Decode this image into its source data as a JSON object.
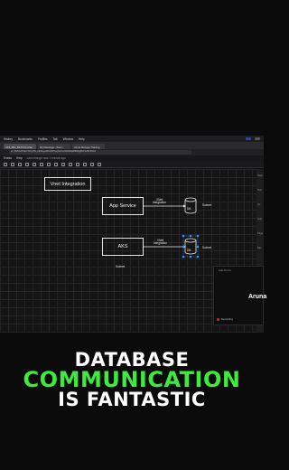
{
  "menubar": {
    "items": [
      "History",
      "Bookmarks",
      "Profiles",
      "Tab",
      "Window",
      "Help"
    ]
  },
  "tabs": [
    {
      "label": "AZ1_IBN_BATCH1(shar..."
    },
    {
      "label": "My Meetings - Zoom"
    },
    {
      "label": "Azure Devops Training"
    }
  ],
  "urlbar": {
    "url": "e/_dNOLd?tdsl=%1QTN_IdhtesgaWu31Z=sgfsd=cctf4AfdqsB8&9g9ht=s2#VH%G"
  },
  "app_header": {
    "menu_extras": "Extras",
    "menu_help": "Help",
    "last_change": "Last change was 1 minute ago"
  },
  "right_panel": {
    "labels": [
      "Style",
      "Text",
      "Arr",
      "Grid",
      "Page",
      "Bac"
    ]
  },
  "diagram": {
    "vnet_label": "Vnet Integration",
    "app_service_label": "App Service",
    "aks_label": "AKS",
    "conn1_label": "VNet\nIntegration",
    "conn2_label": "VNet\nIntegration",
    "db1_label": "DB",
    "db2_label": "DB",
    "subnet1_label": "Subnet",
    "subnet2_label": "Subnet",
    "subnet3_label": "Subnet"
  },
  "webcam": {
    "title": "Ask Aruna",
    "name": "Aruna",
    "recording": "Recording"
  },
  "caption": {
    "line1": "DATABASE",
    "line2": "COMMUNICATION",
    "line3": "IS FANTASTIC"
  },
  "colors": {
    "accent_green": "#3dea3d",
    "caption_white": "#ffffff"
  }
}
